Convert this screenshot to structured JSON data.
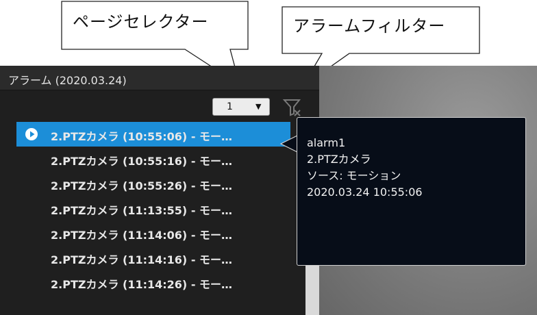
{
  "callouts": {
    "page_selector": "ページセレクター",
    "alarm_filter": "アラームフィルター"
  },
  "panel": {
    "title": "アラーム (2020.03.24)",
    "page_select": {
      "value": "1",
      "caret": "▼"
    },
    "filter_icon": "filter-icon",
    "play_icon": "play-icon"
  },
  "alarms": [
    {
      "label": "2.PTZカメラ (10:55:06) - モー…",
      "selected": true
    },
    {
      "label": "2.PTZカメラ (10:55:16) - モー…",
      "selected": false
    },
    {
      "label": "2.PTZカメラ (10:55:26) - モー…",
      "selected": false
    },
    {
      "label": "2.PTZカメラ (11:13:55) - モー…",
      "selected": false
    },
    {
      "label": "2.PTZカメラ (11:14:06) - モー…",
      "selected": false
    },
    {
      "label": "2.PTZカメラ (11:14:16) - モー…",
      "selected": false
    },
    {
      "label": "2.PTZカメラ (11:14:26) - モー…",
      "selected": false
    }
  ],
  "tooltip": {
    "line1": "alarm1",
    "line2": "2.PTZカメラ",
    "line3": "ソース: モーション",
    "line4": "2020.03.24 10:55:06"
  },
  "colors": {
    "selection": "#1c8ed8",
    "panel_bg": "#1f1f1f",
    "tooltip_bg": "#070d18"
  }
}
